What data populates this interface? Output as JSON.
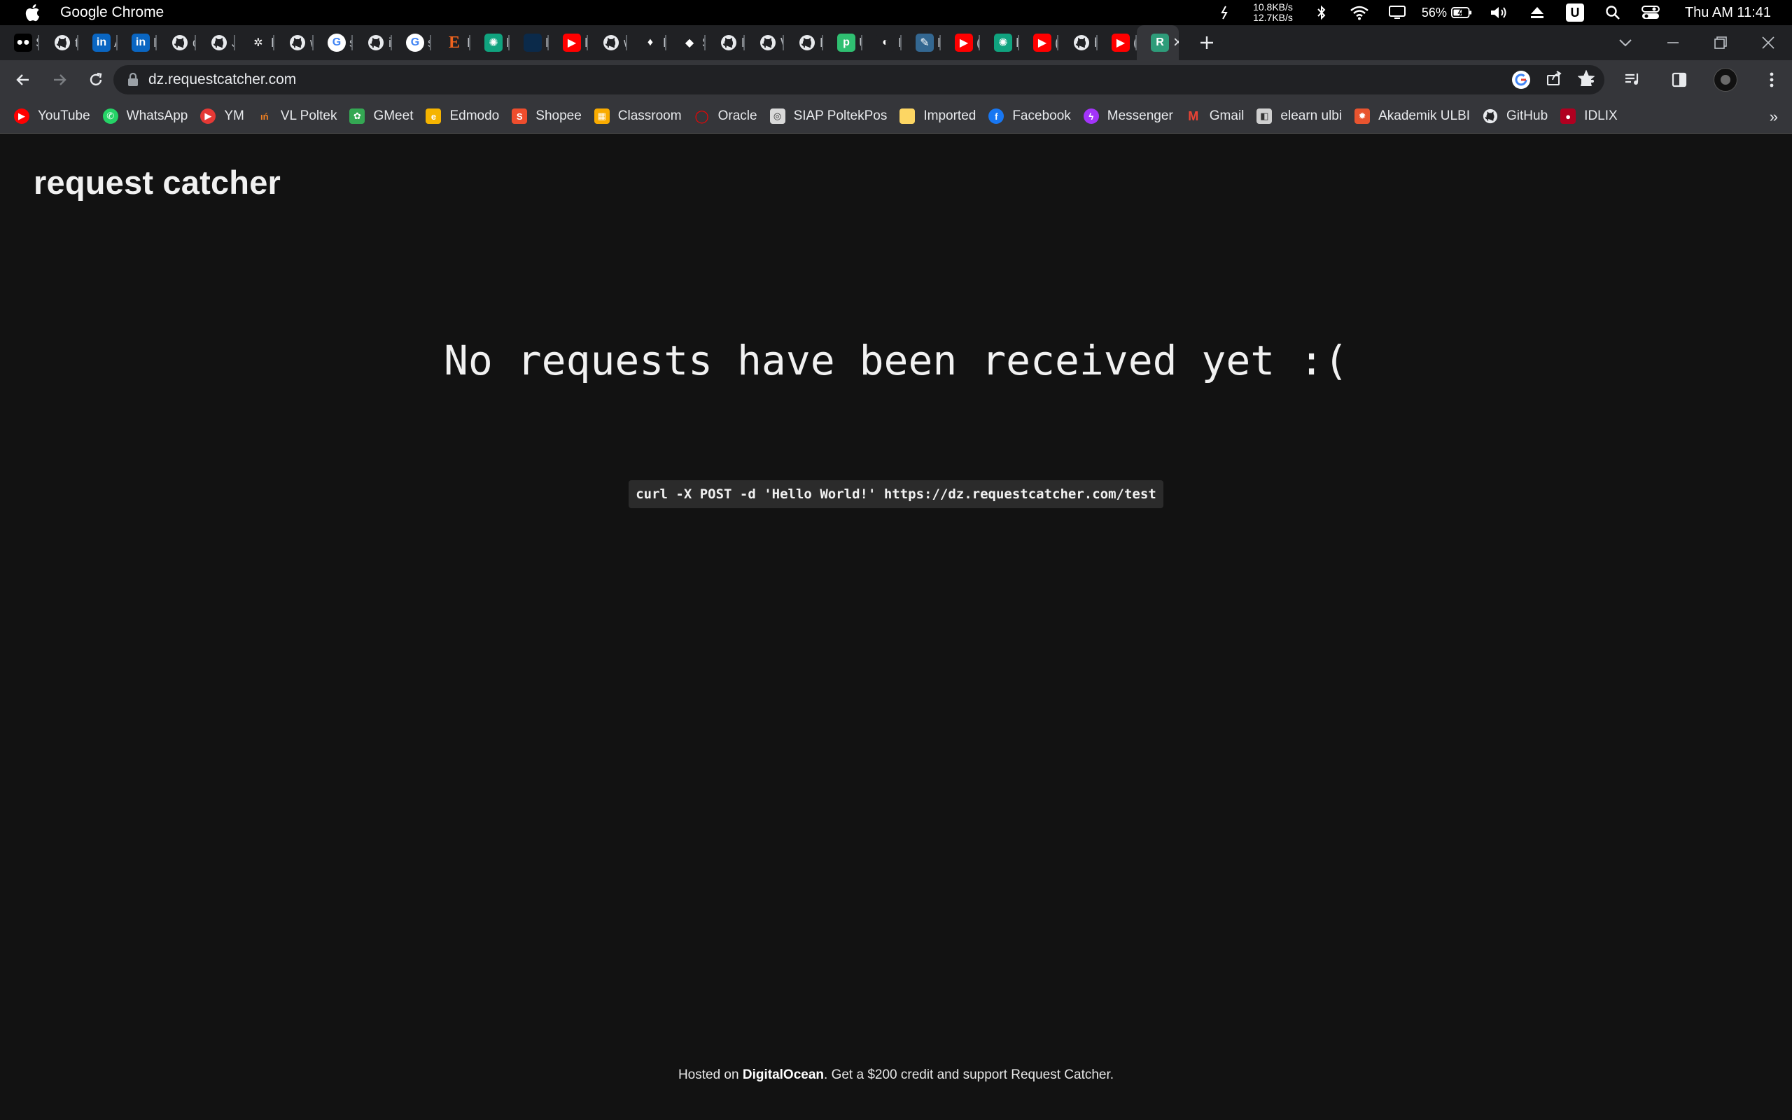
{
  "menubar": {
    "app_name": "Google Chrome",
    "net_up": "10.8KB/s",
    "net_down": "12.7KB/s",
    "battery": "56%",
    "clock": "Thu AM 11:41",
    "u_badge": "U"
  },
  "tabs": [
    {
      "label": "St",
      "icon": "medium-icon",
      "color": "#000000",
      "glyph": "●●"
    },
    {
      "label": "tu",
      "icon": "github-icon",
      "color": "#202124",
      "glyph": ""
    },
    {
      "label": "A",
      "icon": "linkedin-icon",
      "color": "#0a66c2",
      "glyph": "in"
    },
    {
      "label": "Er",
      "icon": "linkedin-icon",
      "color": "#0a66c2",
      "glyph": "in"
    },
    {
      "label": "d",
      "icon": "github-icon",
      "color": "#202124",
      "glyph": ""
    },
    {
      "label": "Jc",
      "icon": "github-icon",
      "color": "#202124",
      "glyph": ""
    },
    {
      "label": "K",
      "icon": "kaggle-icon",
      "color": "#202124",
      "glyph": "✲"
    },
    {
      "label": "w",
      "icon": "github-icon",
      "color": "#202124",
      "glyph": ""
    },
    {
      "label": "sl",
      "icon": "google-icon",
      "color": "#ffffff",
      "glyph": "G"
    },
    {
      "label": "in",
      "icon": "github-icon",
      "color": "#202124",
      "glyph": ""
    },
    {
      "label": "sc",
      "icon": "google-icon",
      "color": "#ffffff",
      "glyph": "G"
    },
    {
      "label": "D",
      "icon": "etsy-icon",
      "color": "#202124",
      "glyph": "E"
    },
    {
      "label": "N",
      "icon": "chatgpt-icon",
      "color": "#10a37f",
      "glyph": "✺"
    },
    {
      "label": "D",
      "icon": "dark-site-icon",
      "color": "#0b2a4a",
      "glyph": ""
    },
    {
      "label": "Bl",
      "icon": "youtube-icon",
      "color": "#ff0000",
      "glyph": "▶"
    },
    {
      "label": "w",
      "icon": "github-icon",
      "color": "#202124",
      "glyph": ""
    },
    {
      "label": "Lc",
      "icon": "mongodb-icon",
      "color": "#202124",
      "glyph": "♦"
    },
    {
      "label": "St",
      "icon": "diamond-icon",
      "color": "#202124",
      "glyph": "◆"
    },
    {
      "label": "Ec",
      "icon": "github-icon",
      "color": "#202124",
      "glyph": ""
    },
    {
      "label": "W",
      "icon": "github-icon",
      "color": "#202124",
      "glyph": ""
    },
    {
      "label": "E",
      "icon": "github-icon",
      "color": "#202124",
      "glyph": ""
    },
    {
      "label": "U",
      "icon": "pusher-icon",
      "color": "#2fbf71",
      "glyph": "p"
    },
    {
      "label": "R",
      "icon": "render-icon",
      "color": "#202124",
      "glyph": "◐"
    },
    {
      "label": "P",
      "icon": "postgres-icon",
      "color": "#336791",
      "glyph": "✎"
    },
    {
      "label": "(1",
      "icon": "youtube-icon",
      "color": "#ff0000",
      "glyph": "▶"
    },
    {
      "label": "M",
      "icon": "chatgpt-icon",
      "color": "#10a37f",
      "glyph": "✺"
    },
    {
      "label": "(1",
      "icon": "youtube-icon",
      "color": "#ff0000",
      "glyph": "▶"
    },
    {
      "label": "b",
      "icon": "github-icon",
      "color": "#202124",
      "glyph": ""
    },
    {
      "label": "(1",
      "icon": "youtube-icon",
      "color": "#ff0000",
      "glyph": "▶"
    }
  ],
  "active_tab": {
    "icon": "requestcatcher-icon",
    "color": "#2e9c7a",
    "glyph": "R"
  },
  "address_bar": {
    "url": "dz.requestcatcher.com"
  },
  "bookmarks": [
    {
      "label": "YouTube",
      "icon": "youtube-icon",
      "color": "#ff0000",
      "glyph": "▶"
    },
    {
      "label": "WhatsApp",
      "icon": "whatsapp-icon",
      "color": "#25d366",
      "glyph": "✆"
    },
    {
      "label": "YM",
      "icon": "ym-icon",
      "color": "#e53935",
      "glyph": "▶"
    },
    {
      "label": "VL Poltek",
      "icon": "vl-poltek-icon",
      "color": "#35363a",
      "glyph": "ıń"
    },
    {
      "label": "GMeet",
      "icon": "gmeet-icon",
      "color": "#34a853",
      "glyph": "✿"
    },
    {
      "label": "Edmodo",
      "icon": "edmodo-icon",
      "color": "#f5b400",
      "glyph": "e"
    },
    {
      "label": "Shopee",
      "icon": "shopee-icon",
      "color": "#ee4d2d",
      "glyph": "S"
    },
    {
      "label": "Classroom",
      "icon": "classroom-icon",
      "color": "#f9ab00",
      "glyph": "▦"
    },
    {
      "label": "Oracle",
      "icon": "oracle-icon",
      "color": "#35363a",
      "glyph": "◯"
    },
    {
      "label": "SIAP PoltekPos",
      "icon": "siap-icon",
      "color": "#d9d9d9",
      "glyph": "◎"
    },
    {
      "label": "Imported",
      "icon": "folder-icon",
      "color": "#fdd663",
      "glyph": ""
    },
    {
      "label": "Facebook",
      "icon": "facebook-icon",
      "color": "#1877f2",
      "glyph": "f"
    },
    {
      "label": "Messenger",
      "icon": "messenger-icon",
      "color": "#a334fa",
      "glyph": "ϟ"
    },
    {
      "label": "Gmail",
      "icon": "gmail-icon",
      "color": "#35363a",
      "glyph": "M"
    },
    {
      "label": "elearn ulbi",
      "icon": "elearn-icon",
      "color": "#cfcfcf",
      "glyph": "◧"
    },
    {
      "label": "Akademik ULBI",
      "icon": "akademik-icon",
      "color": "#e8542f",
      "glyph": "✹"
    },
    {
      "label": "GitHub",
      "icon": "github-icon",
      "color": "#35363a",
      "glyph": ""
    },
    {
      "label": "IDLIX",
      "icon": "idlix-icon",
      "color": "#b00020",
      "glyph": "●"
    }
  ],
  "bookmarks_more": "»",
  "page": {
    "title": "request catcher",
    "empty_message": "No requests have been received yet :(",
    "curl_command": "curl -X POST -d 'Hello World!' https://dz.requestcatcher.com/test",
    "footer_prefix": "Hosted on ",
    "footer_link": "DigitalOcean",
    "footer_suffix": ". Get a $200 credit and support Request Catcher."
  }
}
